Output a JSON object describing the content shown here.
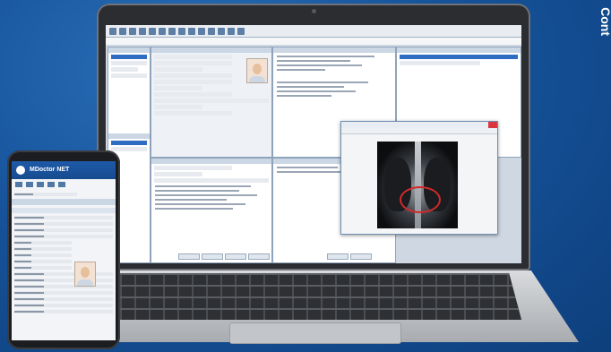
{
  "side_label": "Cont",
  "phone": {
    "brand": "MDoctor NET"
  },
  "icons": {
    "laptop_toolbar": [
      "save-icon",
      "print-icon",
      "search-icon",
      "folder-icon",
      "calendar-icon",
      "settings-icon",
      "help-icon"
    ],
    "phone_toolbar": [
      "home-icon",
      "patient-icon",
      "agenda-icon",
      "message-icon",
      "exit-icon"
    ]
  },
  "colors": {
    "background": "#16539b",
    "header_blue": "#1e5aa8",
    "selection": "#2f6dc2",
    "highlight_circle": "#d12a2a"
  }
}
